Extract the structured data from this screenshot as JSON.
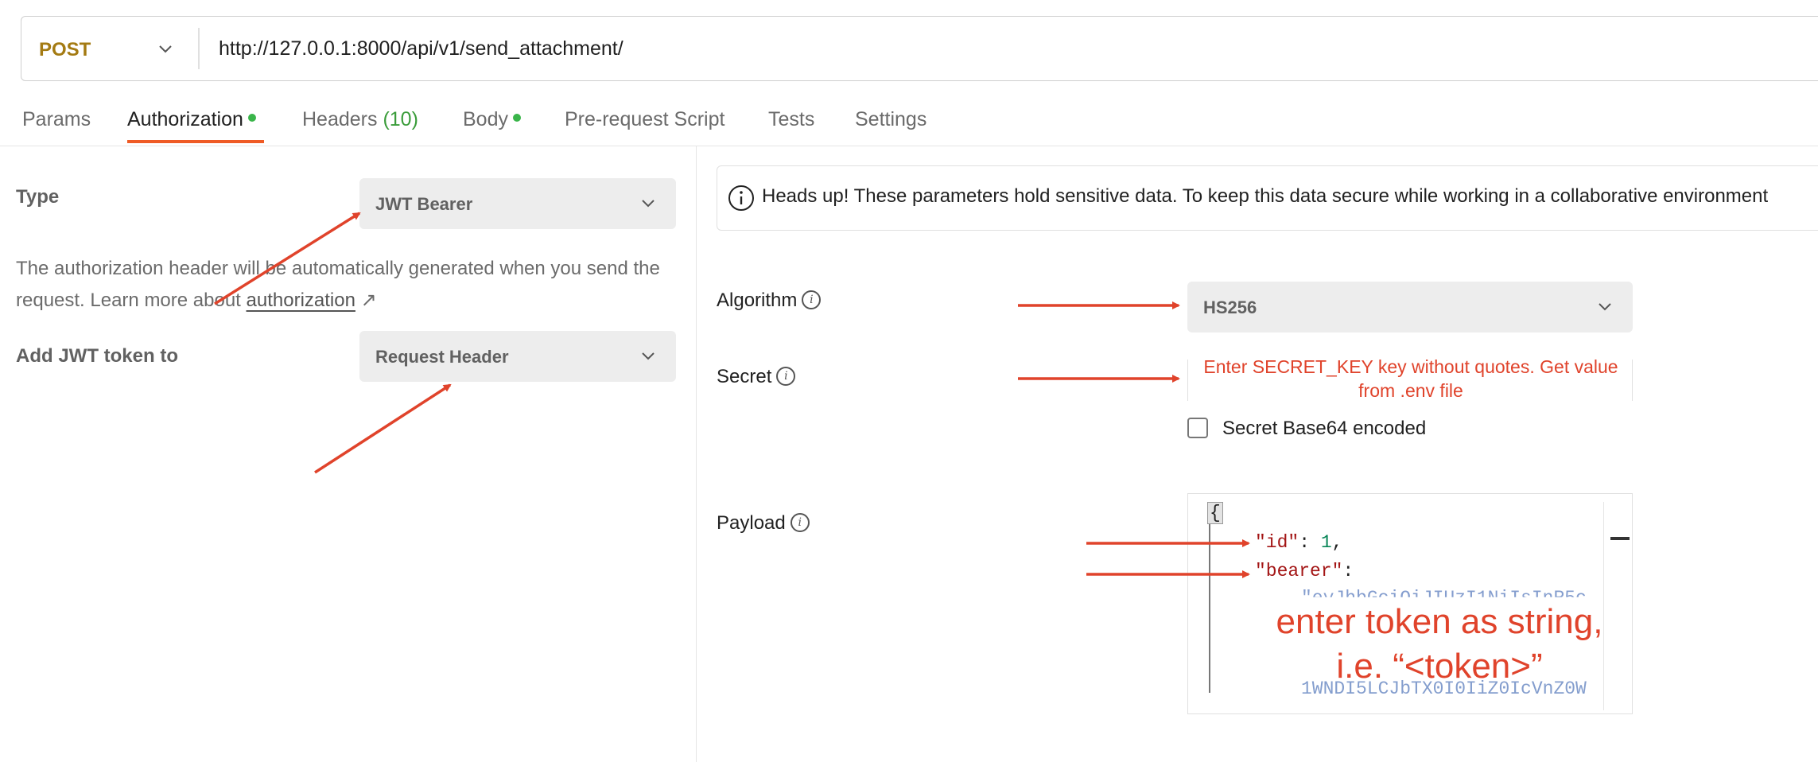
{
  "request": {
    "method": "POST",
    "url": "http://127.0.0.1:8000/api/v1/send_attachment/"
  },
  "tabs": [
    {
      "label": "Params"
    },
    {
      "label": "Authorization",
      "dot": true
    },
    {
      "label": "Headers",
      "count": "(10)"
    },
    {
      "label": "Body",
      "dot": true
    },
    {
      "label": "Pre-request Script"
    },
    {
      "label": "Tests"
    },
    {
      "label": "Settings"
    }
  ],
  "auth": {
    "type_label": "Type",
    "type_value": "JWT Bearer",
    "description": "The authorization header will be automatically generated when you send the request. Learn more about ",
    "description_link": "authorization",
    "link_arrow": "↗",
    "add_to_label": "Add JWT token to",
    "add_to_value": "Request Header"
  },
  "config": {
    "notice": "Heads up! These parameters hold sensitive data. To keep this data secure while working in a collaborative environment",
    "algorithm_label": "Algorithm",
    "algorithm_value": "HS256",
    "secret_label": "Secret",
    "secret_annotation": "Enter SECRET_KEY key without quotes. Get value from .env file",
    "secret_base64_label": "Secret Base64 encoded",
    "secret_base64_checked": false,
    "payload_label": "Payload",
    "payload_open_brace": "{",
    "payload_key1": "\"id\"",
    "payload_val1": "1",
    "payload_key2": "\"bearer\"",
    "payload_faded1": "\"eyJhbGciOiJIUzI1NiIsInR5c",
    "payload_faded2": "1WNDI5LCJbTX0I0IiZ0IcVnZ0W",
    "payload_annotation": "enter token as string, i.e. “<token>”"
  },
  "colors": {
    "accent": "#ef5b25",
    "method": "#a47b13",
    "annotation": "#e0432b",
    "status_dot": "#3ab54a"
  },
  "icons": [
    "chevron-down-icon",
    "info-icon",
    "external-link-icon"
  ]
}
